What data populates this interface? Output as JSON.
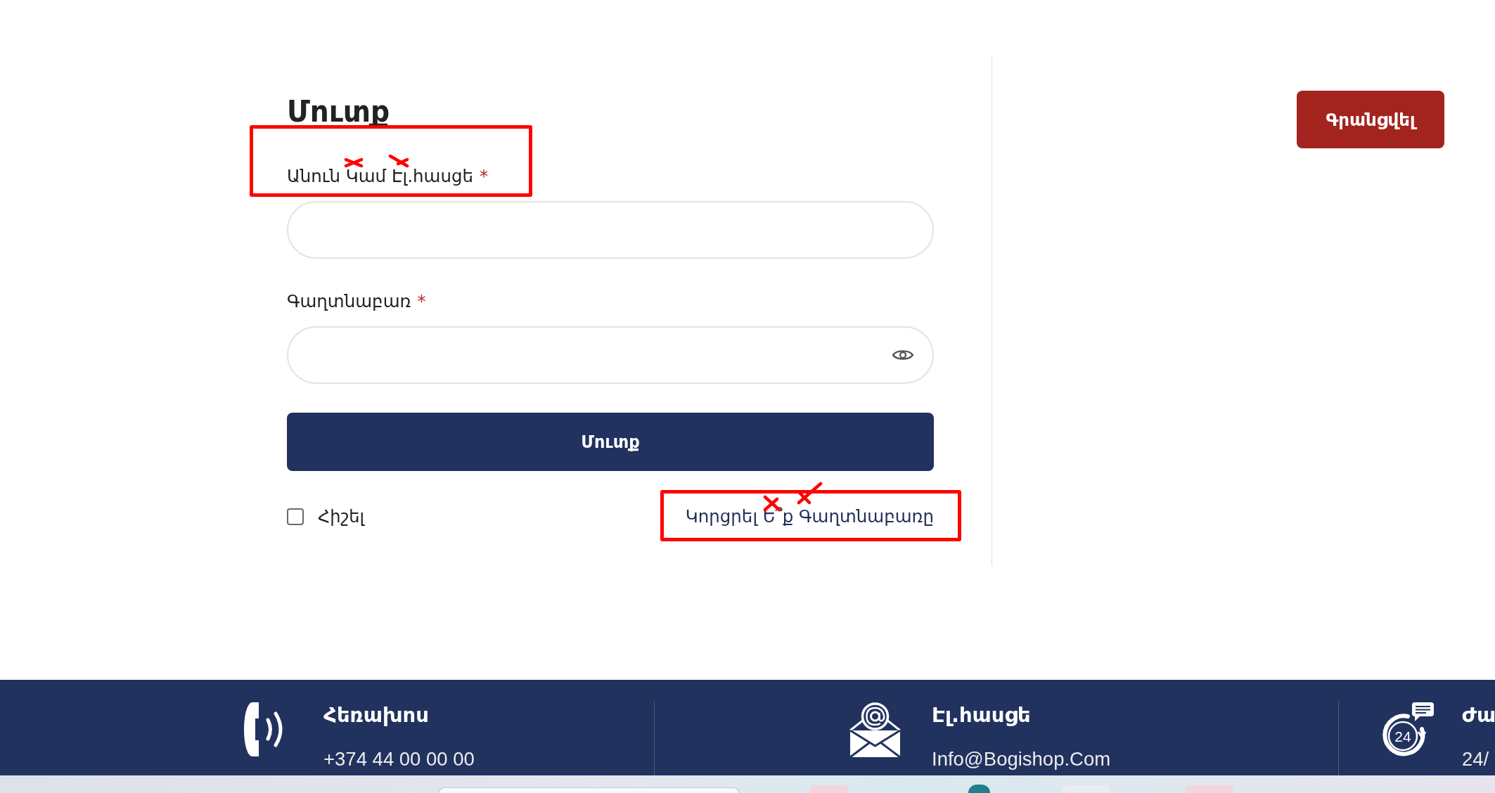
{
  "login_form": {
    "title": "Մուտք",
    "fields": [
      {
        "kind": "text",
        "label": "Անուն Կամ Էլ.հասցե",
        "required_mark": "*",
        "annotated": true
      },
      {
        "kind": "password",
        "label": "Գաղտնաբառ",
        "required_mark": "*",
        "annotated": false
      }
    ],
    "submit_button": "Մուտք",
    "remember": {
      "label": "Հիշել",
      "checked": false
    },
    "forgot_link": {
      "text": "Կորցրել Ե՞ք Գաղտնաբառը",
      "annotated": true
    }
  },
  "register_button": "Գրանցվել",
  "footer": {
    "contacts": [
      {
        "kind": "phone",
        "title": "Հեռախոս",
        "value": "+374 44 00 00 00"
      },
      {
        "kind": "email",
        "title": "Էլ.հասցե",
        "value": "Info@Bogishop.Com"
      },
      {
        "kind": "hours",
        "icon_label": "24",
        "title": "Ժա",
        "value": "24/"
      }
    ]
  }
}
